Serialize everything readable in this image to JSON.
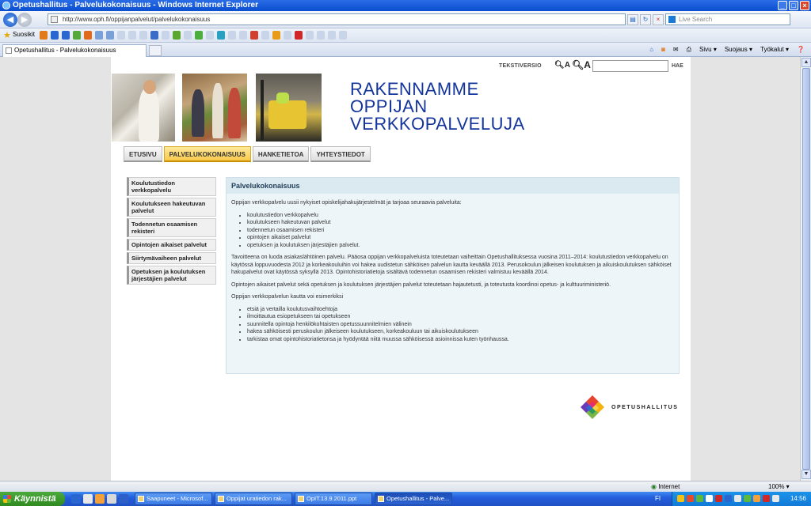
{
  "window": {
    "title": "Opetushallitus - Palvelukokonaisuus - Windows Internet Explorer"
  },
  "browser": {
    "address": "http://www.oph.fi/oppijanpalvelut/palvelukokonaisuus",
    "search_placeholder": "Live Search",
    "favorites_label": "Suosikit",
    "tab_title": "Opetushallitus - Palvelukokonaisuus",
    "commands": [
      "Sivu ▾",
      "Suojaus ▾",
      "Työkalut ▾"
    ],
    "status_zone": "Internet",
    "zoom": "100% ▾"
  },
  "site": {
    "text_version": "TEKSTIVERSIO",
    "search_button": "HAE",
    "headline": [
      "RAKENNAMME",
      "OPPIJAN",
      "VERKKOPALVELUJA"
    ],
    "nav": [
      "ETUSIVU",
      "PALVELUKOKONAISUUS",
      "HANKETIETOA",
      "YHTEYSTIEDOT"
    ],
    "active_nav": 1,
    "side_nav": [
      "Koulutustiedon verkkopalvelu",
      "Koulutukseen hakeutuvan palvelut",
      "Todennetun osaamisen rekisteri",
      "Opintojen aikaiset palvelut",
      "Siirtymävaiheen palvelut",
      "Opetuksen ja koulutuksen järjestäjien palvelut"
    ],
    "content_title": "Palvelukokonaisuus",
    "intro": "Oppijan verkkopalvelu uusii nykyiset opiskelijahakujärjestelmät ja tarjoaa seuraavia palveluita:",
    "services": [
      "koulutustiedon verkkopalvelu",
      "koulutukseen hakeutuvan palvelut",
      "todennetun osaamisen rekisteri",
      "opintojen aikaiset palvelut",
      "opetuksen ja koulutuksen järjestäjien palvelut."
    ],
    "para2": "Tavoitteena on luoda asiakaslähtöinen palvelu. Pääosa oppijan verkkopalveluista toteutetaan vaiheittain Opetushallituksessa vuosina 2011–2014: koulutustiedon verkkopalvelu on käytössä loppuvuodesta 2012 ja korkeakouluihin voi hakea uudistetun sähköisen palvelun kautta keväällä 2013. Perusokoulun jälkeisen koulutuksen ja aikuiskoulutuksen sähköiset hakupalvelut ovat käytössä syksyllä 2013. Opintohistoriatietoja sisältävä todennetun osaamisen rekisteri valmistuu keväällä 2014.",
    "para3": "Opintojen aikaiset palvelut sekä opetuksen ja koulutuksen järjestäjien palvelut toteutetaan hajautetusti, ja toteutusta koordinoi opetus- ja kulttuuriministeriö.",
    "para4": "Oppijan verkkopalvelun kautta voi esimerkiksi",
    "examples": [
      "etsiä ja vertailla koulutusvaihtoehtoja",
      "ilmoittautua esiopetukseen tai opetukseen",
      "suunnitella opintoja henkilökohtaisten opetussuunnitelmien välinein",
      "hakea sähköisesti peruskoulun jälkeiseen koulutukseen, korkeakouluun tai aikuiskoulutukseen",
      "tarkistaa omat opintohistoriatietonsa ja hyödyntää niitä muussa sähköisessä asioinnissa kuten työnhaussa."
    ],
    "logo_text": "OPETUSHALLITUS"
  },
  "taskbar": {
    "start": "Käynnistä",
    "tasks": [
      "Saapuneet - Microsof...",
      "Oppijat uratiedon rak...",
      "OpIT.13.9.2011.ppt",
      "Opetushallitus - Palve..."
    ],
    "active_task": 3,
    "lang": "FI",
    "clock": "14:56"
  },
  "colors": {
    "headline": "#13359c",
    "active_tab": "#f7c94b",
    "content_bg": "#eef5f9"
  }
}
